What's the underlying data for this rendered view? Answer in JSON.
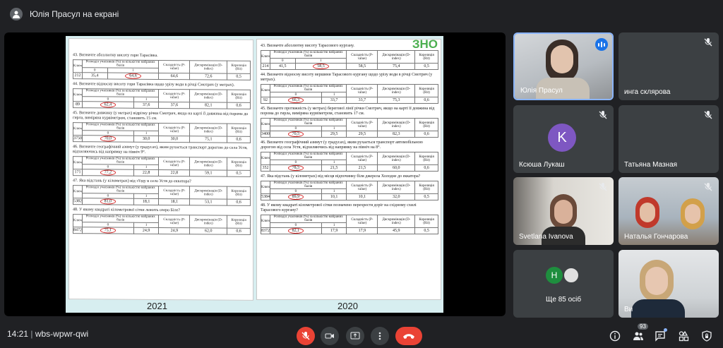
{
  "topbar": {
    "title": "Юлія Прасул на екрані"
  },
  "bottombar": {
    "time": "14:21",
    "separator": "|",
    "meeting_code": "wbs-wpwr-qwi",
    "participants_badge": "93"
  },
  "participants": {
    "p1": {
      "name": "Юлія Прасул"
    },
    "p2": {
      "name": "инга склярова"
    },
    "p3": {
      "name": "Ксюша Лукаш",
      "initial": "K"
    },
    "p4": {
      "name": "Татьяна Мазная"
    },
    "p5": {
      "name": "Svetlana Ivanova"
    },
    "p6": {
      "name": "Наталья Гончарова"
    },
    "p7": {
      "name": "Ще 85 осіб",
      "initial": "H"
    },
    "p8": {
      "name": "Ви"
    }
  },
  "doc": {
    "zno": "ЗНО",
    "year_left": "2021",
    "year_right": "2020",
    "head": {
      "col1": "Ключ",
      "col2": "Розподіл учасників (%) за кількістю набраних балів",
      "col3": "Складність (P-value)",
      "col4": "Дискримінація (D-index)",
      "col5": "Кореляція (Rit)",
      "sub0": "0",
      "sub1": "1"
    },
    "left": {
      "q43": "43. Визначте абсолютну висоту гори Тарасівка.",
      "r43": [
        "212",
        "35,4",
        "64,6",
        "64,6",
        "72,6",
        "0,5"
      ],
      "q44": "44. Визначте відносну висоту гори Тарасівка щодо урізу води в річці Смотрич (у метрах).",
      "r44": [
        "89",
        "62,4",
        "37,6",
        "37,6",
        "82,1",
        "0,6"
      ],
      "q45": "45. Визначте довжину (у метрах) відрізку річки Смотрич, якщо на карті її довжина від порома до гирла, виміряна курвіметром, становить 15 см.",
      "r45": [
        "3750",
        "70,0",
        "30,0",
        "30,0",
        "75,1",
        "0,6"
      ],
      "q46": "46. Визначте географічний азимут (у градусах), яким рухається транспорт дорогою до села Устя, відхиляючись від напрямку на північ 9°.",
      "r46": [
        "171",
        "77,2",
        "22,8",
        "22,8",
        "59,1",
        "0,5"
      ],
      "q47": "47. Яка відстань (у кілометрах) від з'їзду в село Устя до еккатора?",
      "r47": [
        "5382",
        "81,0",
        "18,1",
        "18,1",
        "53,1",
        "0,6"
      ],
      "q48": "48. У якому квадраті кілометрової сітки лежить озеро Біле?",
      "r48": [
        "8472",
        "75,1",
        "24,9",
        "24,9",
        "62,0",
        "0,6"
      ]
    },
    "right": {
      "q43": "43. Визначте абсолютну висоту Тарасового кургану.",
      "r43": [
        "214",
        "41,5",
        "58,5",
        "58,5",
        "75,4",
        "0,5"
      ],
      "q44": "44. Визначте відносну висоту вершини Тарасового кургану щодо урізу води в річці Смотрич (у метрах).",
      "r44": [
        "92",
        "66,3",
        "33,7",
        "33,7",
        "75,3",
        "0,6"
      ],
      "q45": "45. Визначте протяжність (у метрах) берегової лінії річки Смотрич, якщо на карті її довжина від порома до гирла, виміряна курвіметром, становить 17 см.",
      "r45": [
        "3400",
        "70,5",
        "29,5",
        "29,5",
        "82,3",
        "0,6"
      ],
      "q46": "46. Визначте географічний азимут (у градусах), яким рухається транспорт автомобільною дорогою від села Устя, відхиляючись від напрямку на північ на 8°.",
      "r46": [
        "352",
        "78,5",
        "21,5",
        "21,5",
        "60,0",
        "0,6"
      ],
      "q47": "47. Яка відстань (у кілометрах) від місця відпочинку біля джерела Холодне до еккатора?",
      "r47": [
        "5384",
        "89,9",
        "10,1",
        "10,1",
        "32,0",
        "0,5"
      ],
      "q48": "48. У якому квадраті кілометрової сітки позначено перехрестя доріг на східному схилі Тарасового кургану?",
      "r48": [
        "8372",
        "82,1",
        "17,9",
        "17,9",
        "45,9",
        "0,5"
      ]
    }
  }
}
